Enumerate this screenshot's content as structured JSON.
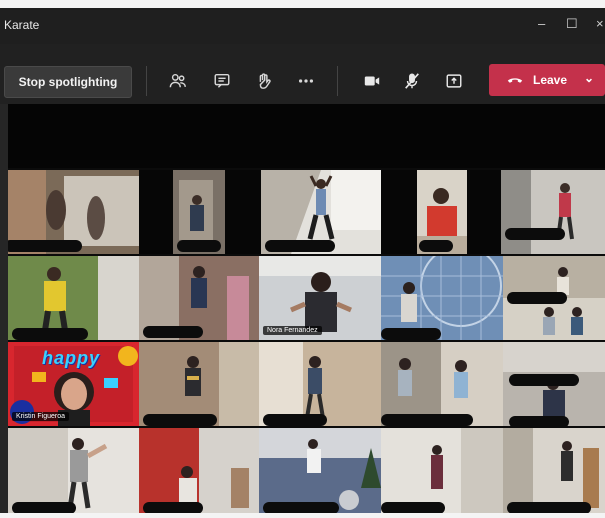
{
  "window": {
    "title": "Karate",
    "minimize": "–",
    "maximize": "☐",
    "close": "×"
  },
  "toolbar": {
    "spotlight_label": "Stop spotlighting",
    "leave_label": "Leave",
    "icons": [
      "people-icon",
      "chat-icon",
      "raise-hand-icon",
      "more-options-icon",
      "camera-icon",
      "mic-off-icon",
      "share-screen-icon"
    ]
  },
  "participants": [
    {
      "label": ""
    },
    {
      "label": "Nora Fernandez"
    },
    {
      "label": "Kristin Figueroa"
    }
  ],
  "artwork": {
    "happy_text": "happy"
  },
  "colors": {
    "leave": "#c4314b",
    "toolbar": "#212121",
    "title_bar": "#1f1f1f"
  }
}
